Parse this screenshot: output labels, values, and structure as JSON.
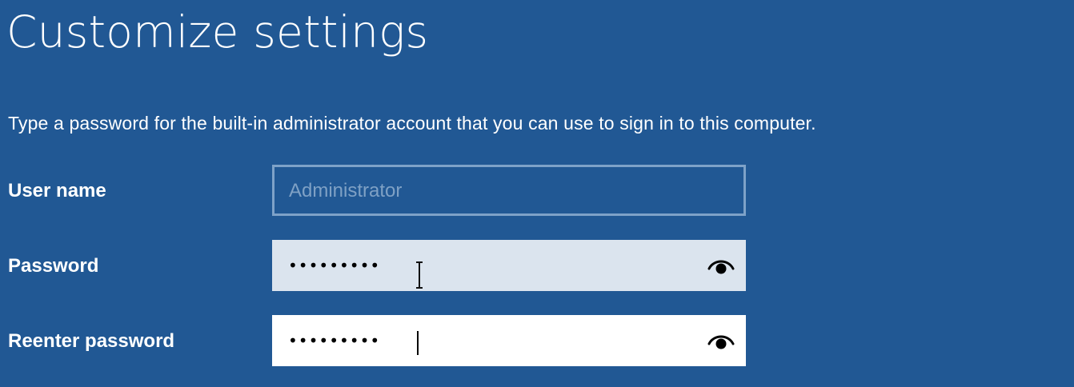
{
  "page": {
    "title": "Customize settings",
    "description": "Type a password for the built-in administrator account that you can use to sign in to this computer."
  },
  "form": {
    "username": {
      "label": "User name",
      "value": "Administrator"
    },
    "password": {
      "label": "Password",
      "masked_value": "•••••••••",
      "reveal_icon": "eye-icon"
    },
    "reenter_password": {
      "label": "Reenter password",
      "masked_value": "•••••••••",
      "reveal_icon": "eye-icon"
    }
  },
  "colors": {
    "background": "#215894",
    "disabled_border": "#7ea2c8",
    "disabled_text": "#7fa1c5",
    "active_field": "#dbe4ee",
    "field": "#ffffff"
  }
}
